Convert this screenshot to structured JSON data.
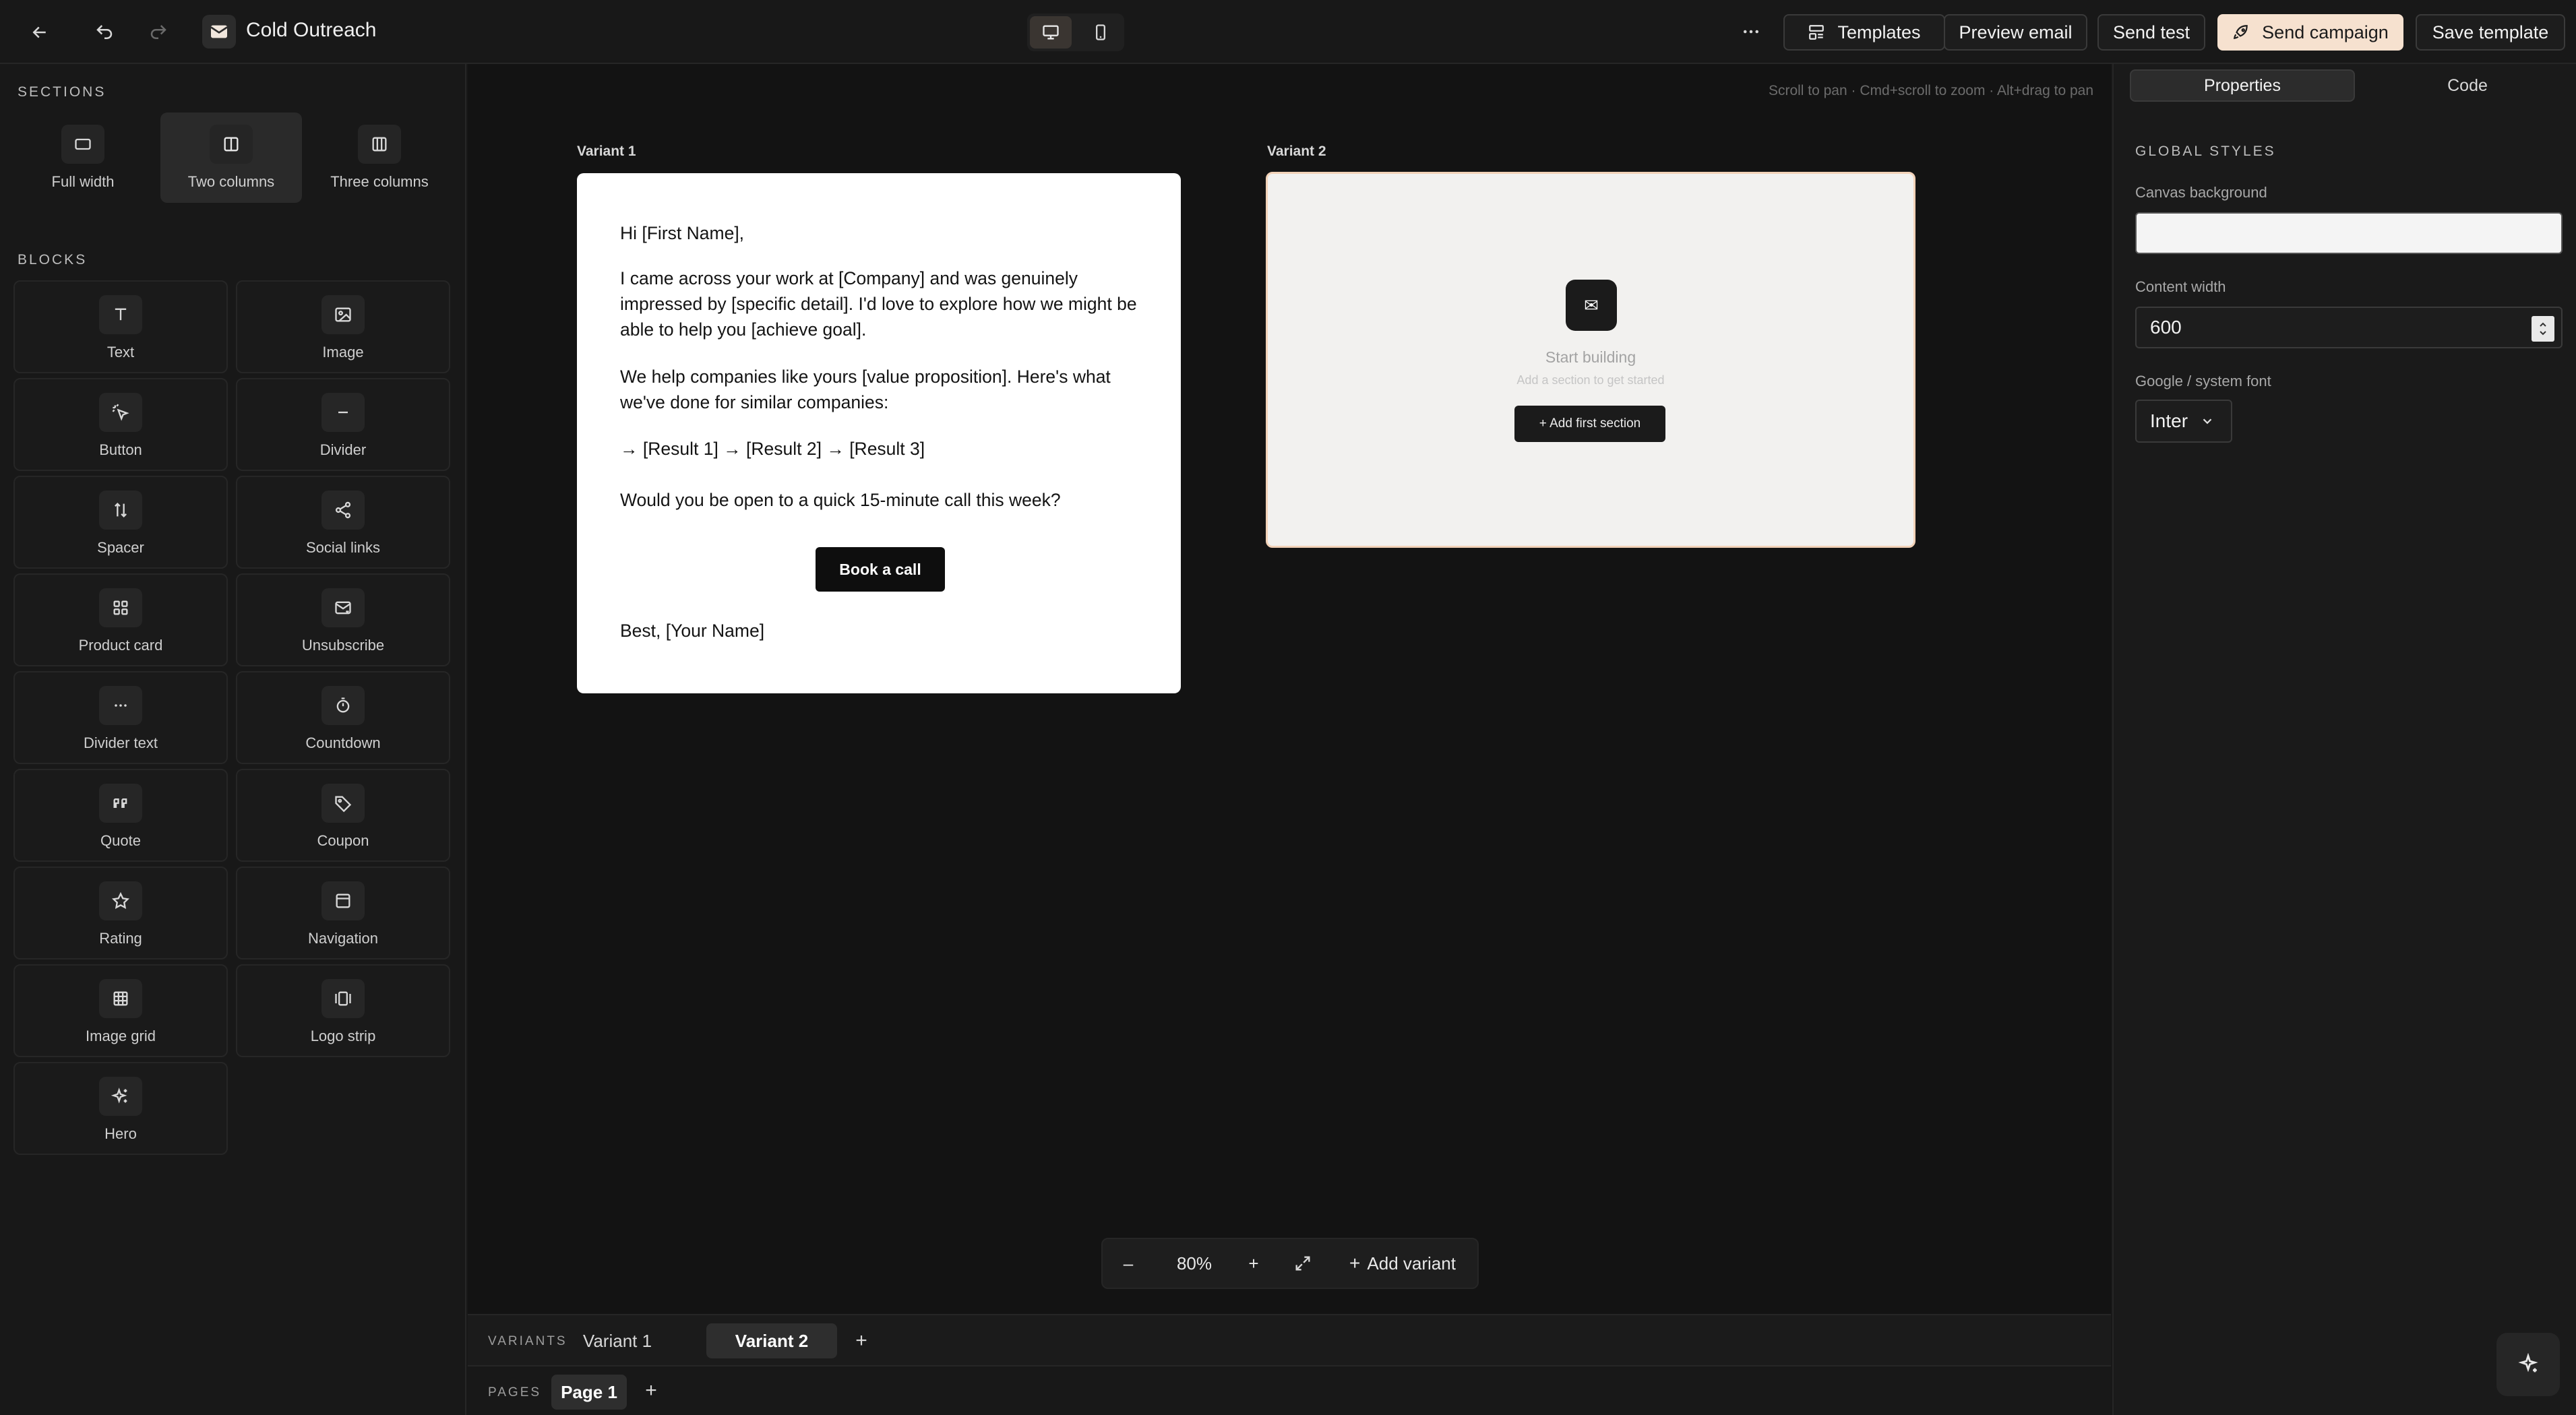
{
  "app": {
    "title": "Cold Outreach",
    "logo_icon": "mail-icon"
  },
  "toolbar": {
    "templates_label": "Templates",
    "preview_label": "Preview email",
    "send_test_label": "Send test",
    "send_campaign_label": "Send campaign",
    "save_template_label": "Save template",
    "accent_color": "#f6e1cf"
  },
  "sidebar": {
    "sections_heading": "SECTIONS",
    "sections": [
      {
        "label": "Full width",
        "icon": "full-width-icon"
      },
      {
        "label": "Two columns",
        "icon": "two-columns-icon",
        "selected": true
      },
      {
        "label": "Three columns",
        "icon": "three-columns-icon"
      }
    ],
    "blocks_heading": "BLOCKS",
    "blocks": [
      {
        "label": "Text",
        "icon": "text-icon"
      },
      {
        "label": "Image",
        "icon": "image-icon"
      },
      {
        "label": "Button",
        "icon": "pointer-icon"
      },
      {
        "label": "Divider",
        "icon": "divider-icon"
      },
      {
        "label": "Spacer",
        "icon": "spacer-icon"
      },
      {
        "label": "Social links",
        "icon": "share-icon"
      },
      {
        "label": "Product card",
        "icon": "grid-icon"
      },
      {
        "label": "Unsubscribe",
        "icon": "mail-x-icon"
      },
      {
        "label": "Divider text",
        "icon": "dots-icon"
      },
      {
        "label": "Countdown",
        "icon": "timer-icon"
      },
      {
        "label": "Quote",
        "icon": "quote-icon"
      },
      {
        "label": "Coupon",
        "icon": "tag-icon"
      },
      {
        "label": "Rating",
        "icon": "star-icon"
      },
      {
        "label": "Navigation",
        "icon": "navigation-icon"
      },
      {
        "label": "Image grid",
        "icon": "table-icon"
      },
      {
        "label": "Logo strip",
        "icon": "gallery-icon"
      },
      {
        "label": "Hero",
        "icon": "sparkles-icon"
      }
    ]
  },
  "canvas": {
    "hint": "Scroll to pan · Cmd+scroll to zoom · Alt+drag to pan",
    "variant1_label": "Variant 1",
    "variant2_label": "Variant 2",
    "email": {
      "greeting": "Hi [First Name],",
      "p1": "I came across your work at [Company] and was genuinely impressed by [specific detail]. I'd love to explore how we might be able to help you [achieve goal].",
      "p2": "We help companies like yours [value proposition]. Here's what we've done for similar companies:",
      "p3": "→ [Result 1] → [Result 2] → [Result 3]",
      "p4": "Would you be open to a quick 15-minute call this week?",
      "cta": "Book a call",
      "signoff": "Best, [Your Name]"
    },
    "empty": {
      "icon": "✉",
      "title": "Start building",
      "subtitle": "Add a section to get started",
      "button": "+ Add first section"
    },
    "zoom": {
      "minus": "–",
      "level": "80%",
      "plus": "+",
      "add_variant": "Add variant"
    }
  },
  "variants_bar": {
    "label": "VARIANTS",
    "tabs": [
      "Variant 1",
      "Variant 2"
    ],
    "active": "Variant 2",
    "add": "+"
  },
  "pages_bar": {
    "label": "PAGES",
    "tabs": [
      "Page 1"
    ],
    "active": "Page 1",
    "add": "+"
  },
  "properties": {
    "tab_properties": "Properties",
    "tab_code": "Code",
    "heading": "GLOBAL STYLES",
    "canvas_background_label": "Canvas background",
    "canvas_background_value": "",
    "content_width_label": "Content width",
    "content_width_value": "600",
    "font_label": "Google / system font",
    "font_value": "Inter"
  }
}
